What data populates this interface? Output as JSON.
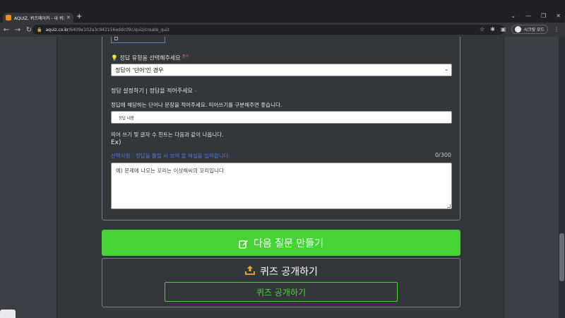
{
  "browser": {
    "tab_title": "AQUIZ, 퀴즈메이커 - 내 퀴즈 만",
    "url_host": "aquiz.co.kr",
    "url_path": "/6409e102a3c942156eddc09c/quiz/create_quiz",
    "profile_label": "시크릿 모드"
  },
  "form": {
    "answer_type_label": "정답 유형을 선택해주세요",
    "required_mark": "필수",
    "answer_type_value": "정답이 '단어'인 경우",
    "answer_setting_label": "정답 설정하기 | 정답을 적어주세요",
    "answer_setting_mark": "-",
    "answer_help": "정답에 해당하는 단어나 문장을 적어주세요. 띄어쓰기를 구분해주면 좋습니다.",
    "answer_placeholder": "정답 내용",
    "hint_info": "띄어 쓰기 및 글자 수 힌트는 다음과 같이 나옵니다.",
    "example_label": "Ex)",
    "optional_label": "선택사항 : 정답을 틀릴 시 보여 줄 해설을 입력합니다.",
    "char_counter": "0/300",
    "explanation_placeholder": "예) 문제에 나오는 꼬리는 이상해씨의 꼬리입니다"
  },
  "actions": {
    "next_question_label": "다음 질문 만들기",
    "publish_title": "퀴즈 공개하기",
    "publish_button_label": "퀴즈 공개하기"
  },
  "colors": {
    "accent_green": "#45d336",
    "link_blue": "#4f74d6",
    "required_red": "#e25c5c"
  }
}
